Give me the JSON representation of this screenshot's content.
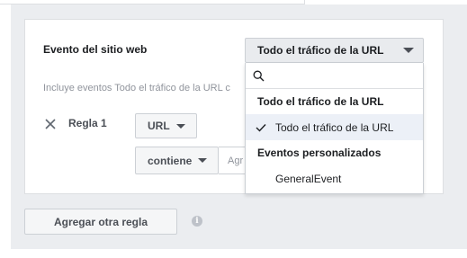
{
  "rule_editor": {
    "event_label": "Evento del sitio web",
    "description": "Incluye eventos Todo el tráfico de la URL c",
    "rule_label": "Regla 1",
    "url_select_value": "URL",
    "operator_select_value": "contiene",
    "value_placeholder": "Agr",
    "add_rule_label": "Agregar otra regla"
  },
  "event_select": {
    "selected": "Todo el tráfico de la URL",
    "dropdown": {
      "search_placeholder": "",
      "group_1": "Todo el tráfico de la URL",
      "group_1_items": [
        "Todo el tráfico de la URL"
      ],
      "group_2": "Eventos personalizados",
      "group_2_items": [
        "GeneralEvent"
      ]
    }
  },
  "colors": {
    "panel_bg": "#ebedf0",
    "selected_item_bg": "#ecf0f7",
    "border": "#ccd0d5"
  },
  "icons": [
    "close-icon",
    "chevron-down-icon",
    "search-icon",
    "check-icon",
    "info-icon"
  ]
}
